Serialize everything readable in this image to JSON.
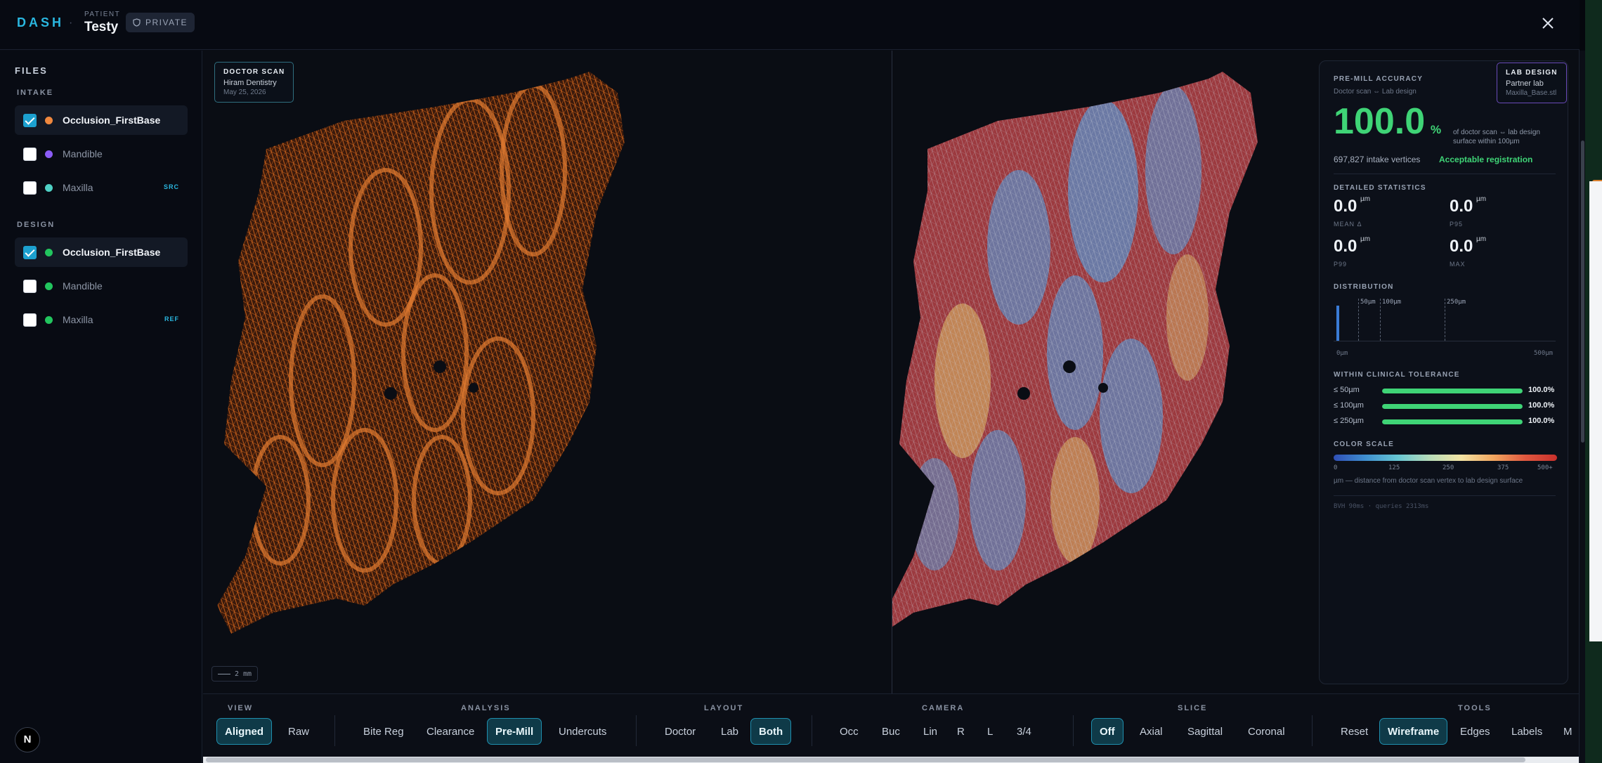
{
  "app": {
    "logo": "DASH",
    "separator": "·"
  },
  "patient": {
    "label": "PATIENT",
    "name": "Testy",
    "privacy": "PRIVATE"
  },
  "sidebar": {
    "title": "FILES",
    "groups": [
      {
        "label": "INTAKE",
        "files": [
          {
            "name": "Occlusion_FirstBase",
            "checked": true,
            "color": "#f0883e",
            "tag": ""
          },
          {
            "name": "Mandible",
            "checked": false,
            "color": "#8b5cf6",
            "tag": ""
          },
          {
            "name": "Maxilla",
            "checked": false,
            "color": "#4fd1c5",
            "tag": "SRC"
          }
        ]
      },
      {
        "label": "DESIGN",
        "files": [
          {
            "name": "Occlusion_FirstBase",
            "checked": true,
            "color": "#22c55e",
            "tag": ""
          },
          {
            "name": "Mandible",
            "checked": false,
            "color": "#22c55e",
            "tag": ""
          },
          {
            "name": "Maxilla",
            "checked": false,
            "color": "#22c55e",
            "tag": "REF"
          }
        ]
      }
    ],
    "nav_badge": "N"
  },
  "viewport": {
    "doctor": {
      "title": "DOCTOR SCAN",
      "clinic": "Hiram Dentistry",
      "date": "May 25, 2026"
    },
    "lab": {
      "title": "LAB DESIGN",
      "lab": "Partner lab",
      "file": "Maxilla_Base.stl"
    },
    "scale": "2 mm",
    "colors": {
      "doctor_mesh": "#d2651c",
      "lab_red": "#c8454b",
      "lab_blue": "#5b8fc7",
      "lab_yellow": "#e0c36a"
    }
  },
  "panel": {
    "heading": "PRE-MILL ACCURACY",
    "subtitle": "Doctor scan ⇔ Lab design",
    "accuracy": "100.0",
    "accuracy_unit": "%",
    "accuracy_desc": "of doctor scan ⇔ lab design surface within 100µm",
    "vertices": "697,827 intake vertices",
    "registration": "Acceptable registration",
    "stats_heading": "DETAILED STATISTICS",
    "stats": [
      {
        "value": "0.0",
        "unit": "µm",
        "label": "MEAN Δ"
      },
      {
        "value": "0.0",
        "unit": "µm",
        "label": "P95"
      },
      {
        "value": "0.0",
        "unit": "µm",
        "label": "P99"
      },
      {
        "value": "0.0",
        "unit": "µm",
        "label": "MAX"
      }
    ],
    "dist_heading": "DISTRIBUTION",
    "dist_marks": [
      "50µm",
      "100µm",
      "250µm"
    ],
    "dist_min": "0µm",
    "dist_max": "500µm",
    "tol_heading": "WITHIN CLINICAL TOLERANCE",
    "tolerance": [
      {
        "label": "≤ 50µm",
        "value": "100.0%",
        "fraction": 1.0
      },
      {
        "label": "≤ 100µm",
        "value": "100.0%",
        "fraction": 1.0
      },
      {
        "label": "≤ 250µm",
        "value": "100.0%",
        "fraction": 1.0
      }
    ],
    "scale_heading": "COLOR SCALE",
    "scale_ticks": [
      "0",
      "125",
      "250",
      "375",
      "500+"
    ],
    "scale_note": "µm — distance from doctor scan vertex to lab design surface",
    "timing": "BVH 90ms · queries 2313ms"
  },
  "toolbar": {
    "groups": {
      "view": "VIEW",
      "analysis": "ANALYSIS",
      "layout": "LAYOUT",
      "camera": "CAMERA",
      "slice": "SLICE",
      "tools": "TOOLS"
    },
    "view": [
      "Aligned",
      "Raw"
    ],
    "analysis": [
      "Bite Reg",
      "Clearance",
      "Pre-Mill",
      "Undercuts"
    ],
    "layout": [
      "Doctor",
      "Lab",
      "Both"
    ],
    "camera": [
      "Occ",
      "Buc",
      "Lin",
      "R",
      "L",
      "3/4"
    ],
    "slice": [
      "Off",
      "Axial",
      "Sagittal",
      "Coronal"
    ],
    "tools": [
      "Reset",
      "Wireframe",
      "Edges",
      "Labels",
      "M"
    ]
  }
}
